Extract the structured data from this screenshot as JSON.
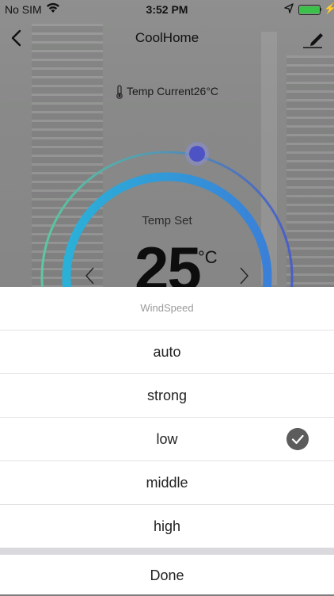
{
  "status_bar": {
    "carrier": "No SIM",
    "time": "3:52 PM",
    "battery_level": 1.0,
    "wifi_icon": "wifi-icon",
    "location_icon": "location-arrow-icon",
    "charging_icon": "bolt-icon"
  },
  "nav": {
    "title": "CoolHome",
    "back_icon": "chevron-left-icon",
    "edit_icon": "pencil-icon"
  },
  "current_temp": {
    "label": "Temp Current26°C",
    "icon": "thermometer-icon"
  },
  "temp_set": {
    "label": "Temp Set",
    "value": "25",
    "unit": "°C",
    "dec_icon": "chevron-left-icon",
    "inc_icon": "chevron-right-icon"
  },
  "colors": {
    "dial_gradient_start": "#5cc8a0",
    "dial_gradient_end": "#4a5ec8",
    "inner_ring": "#2d8fd8",
    "knob": "#4d53c4",
    "check_bg": "#5c5c5c"
  },
  "sheet": {
    "title": "WindSpeed",
    "options": [
      {
        "label": "auto",
        "selected": false
      },
      {
        "label": "strong",
        "selected": false
      },
      {
        "label": "low",
        "selected": true
      },
      {
        "label": "middle",
        "selected": false
      },
      {
        "label": "high",
        "selected": false
      }
    ],
    "check_icon": "checkmark-icon",
    "done_label": "Done"
  }
}
